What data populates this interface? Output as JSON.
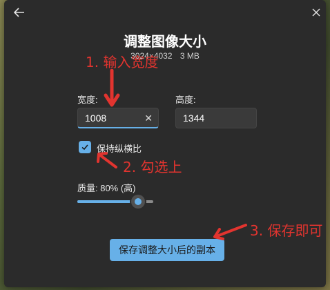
{
  "dialog": {
    "title": "调整图像大小",
    "image_dims": "3024×4032",
    "file_size": "3 MB"
  },
  "width_field": {
    "label": "宽度:",
    "value": "1008"
  },
  "height_field": {
    "label": "高度:",
    "value": "1344"
  },
  "keep_ratio": {
    "label": "保持纵横比",
    "checked": true
  },
  "quality": {
    "label": "质量: 80% (高)",
    "value_percent": 80
  },
  "save_button": {
    "label": "保存调整大小后的副本"
  },
  "annotations": {
    "step1": "1. 输入宽度",
    "step2": "2. 勾选上",
    "step3": "3. 保存即可"
  },
  "colors": {
    "accent": "#67b0e8",
    "annotation": "#e2342f",
    "dialog_bg": "#2b2b2b"
  },
  "icons": {
    "back": "arrow-left-icon",
    "close": "close-icon",
    "clear": "clear-icon",
    "check": "check-icon"
  }
}
